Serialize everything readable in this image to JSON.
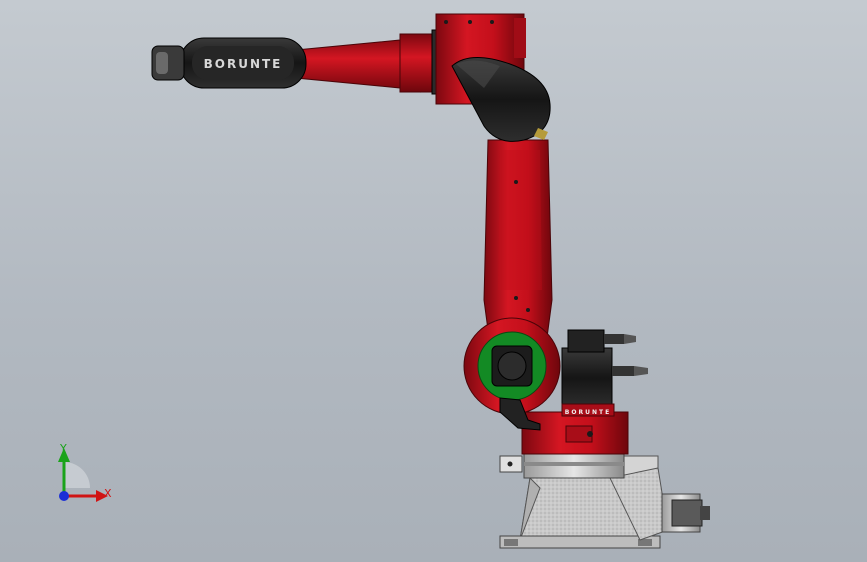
{
  "model": {
    "arm_brand": "BORUNTE",
    "base_brand": "BORUNTE",
    "colors": {
      "background_top": "#c4cad0",
      "background_bottom": "#a9b0b8",
      "body_red": "#c8101c",
      "body_red_dark": "#8e0a12",
      "motor_black": "#1b1b1b",
      "mount_green": "#138a24",
      "base_gray": "#cfcfcf"
    }
  },
  "triad": {
    "y_label": "Y",
    "x_label": "X",
    "y_color": "#1aa31a",
    "x_color": "#d01414",
    "z_color": "#1b2fd6"
  }
}
